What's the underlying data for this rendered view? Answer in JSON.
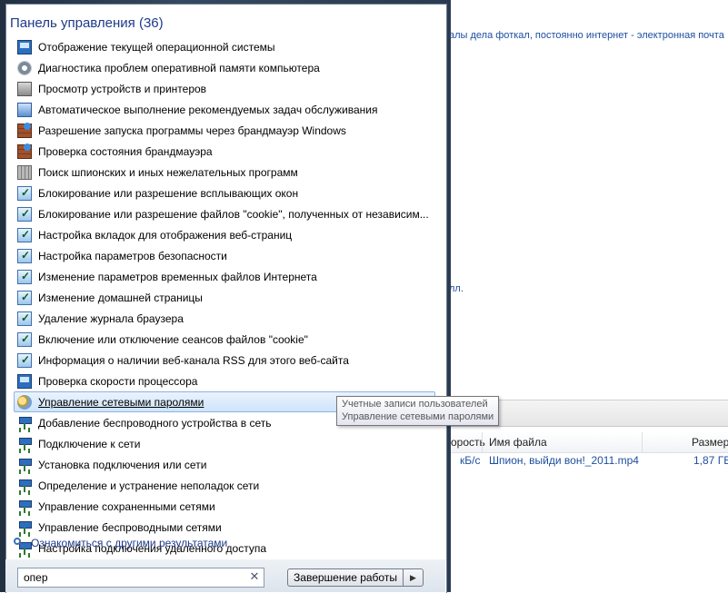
{
  "background": {
    "top_text": "алы дела фоткал, постоянно интернет - электронная почта",
    "mid_text": "лл.",
    "table": {
      "col_speed": "орость",
      "col_file": "Имя файла",
      "col_size": "Размер",
      "row_speed": "кБ/с",
      "row_file": "Шпион, выйди вон!_2011.mp4",
      "row_size": "1,87 ГБ"
    }
  },
  "menu": {
    "group_title": "Панель управления (36)",
    "items": [
      {
        "label": "Отображение текущей операционной системы",
        "icon": "monitor-icon"
      },
      {
        "label": "Диагностика проблем оперативной памяти компьютера",
        "icon": "gear-icon"
      },
      {
        "label": "Просмотр устройств и принтеров",
        "icon": "printer-icon"
      },
      {
        "label": "Автоматическое выполнение рекомендуемых задач обслуживания",
        "icon": "task-icon"
      },
      {
        "label": "Разрешение запуска программы через брандмауэр Windows",
        "icon": "firewall-icon"
      },
      {
        "label": "Проверка состояния брандмауэра",
        "icon": "firewall-icon"
      },
      {
        "label": "Поиск шпионских и иных нежелательных программ",
        "icon": "defender-icon"
      },
      {
        "label": "Блокирование или разрешение всплывающих окон",
        "icon": "internet-options-icon"
      },
      {
        "label": "Блокирование или разрешение файлов \"cookie\", полученных от независим...",
        "icon": "internet-options-icon"
      },
      {
        "label": "Настройка вкладок для отображения веб-страниц",
        "icon": "internet-options-icon"
      },
      {
        "label": "Настройка параметров безопасности",
        "icon": "internet-options-icon"
      },
      {
        "label": "Изменение параметров временных файлов Интернета",
        "icon": "internet-options-icon"
      },
      {
        "label": "Изменение домашней страницы",
        "icon": "internet-options-icon"
      },
      {
        "label": "Удаление журнала браузера",
        "icon": "internet-options-icon"
      },
      {
        "label": "Включение или отключение сеансов файлов \"cookie\"",
        "icon": "internet-options-icon"
      },
      {
        "label": "Информация о наличии веб-канала RSS для этого веб-сайта",
        "icon": "internet-options-icon"
      },
      {
        "label": "Проверка скорости процессора",
        "icon": "monitor-icon"
      },
      {
        "label": "Управление сетевыми паролями",
        "icon": "user-accounts-icon",
        "selected": true
      },
      {
        "label": "Добавление беспроводного устройства в сеть",
        "icon": "network-icon"
      },
      {
        "label": "Подключение к сети",
        "icon": "network-icon"
      },
      {
        "label": "Установка подключения или сети",
        "icon": "network-icon"
      },
      {
        "label": "Определение и устранение неполадок сети",
        "icon": "network-icon"
      },
      {
        "label": "Управление сохраненными сетями",
        "icon": "network-icon"
      },
      {
        "label": "Управление беспроводными сетями",
        "icon": "network-icon"
      },
      {
        "label": "Настройка подключения удаленного доступа",
        "icon": "network-icon"
      }
    ],
    "more_results": "Ознакомиться с другими результатами",
    "search_value": "опер",
    "shutdown_label": "Завершение работы",
    "shutdown_arrow": "▶"
  },
  "tooltip": {
    "line1": "Учетные записи пользователей",
    "line2": "Управление сетевыми паролями"
  }
}
